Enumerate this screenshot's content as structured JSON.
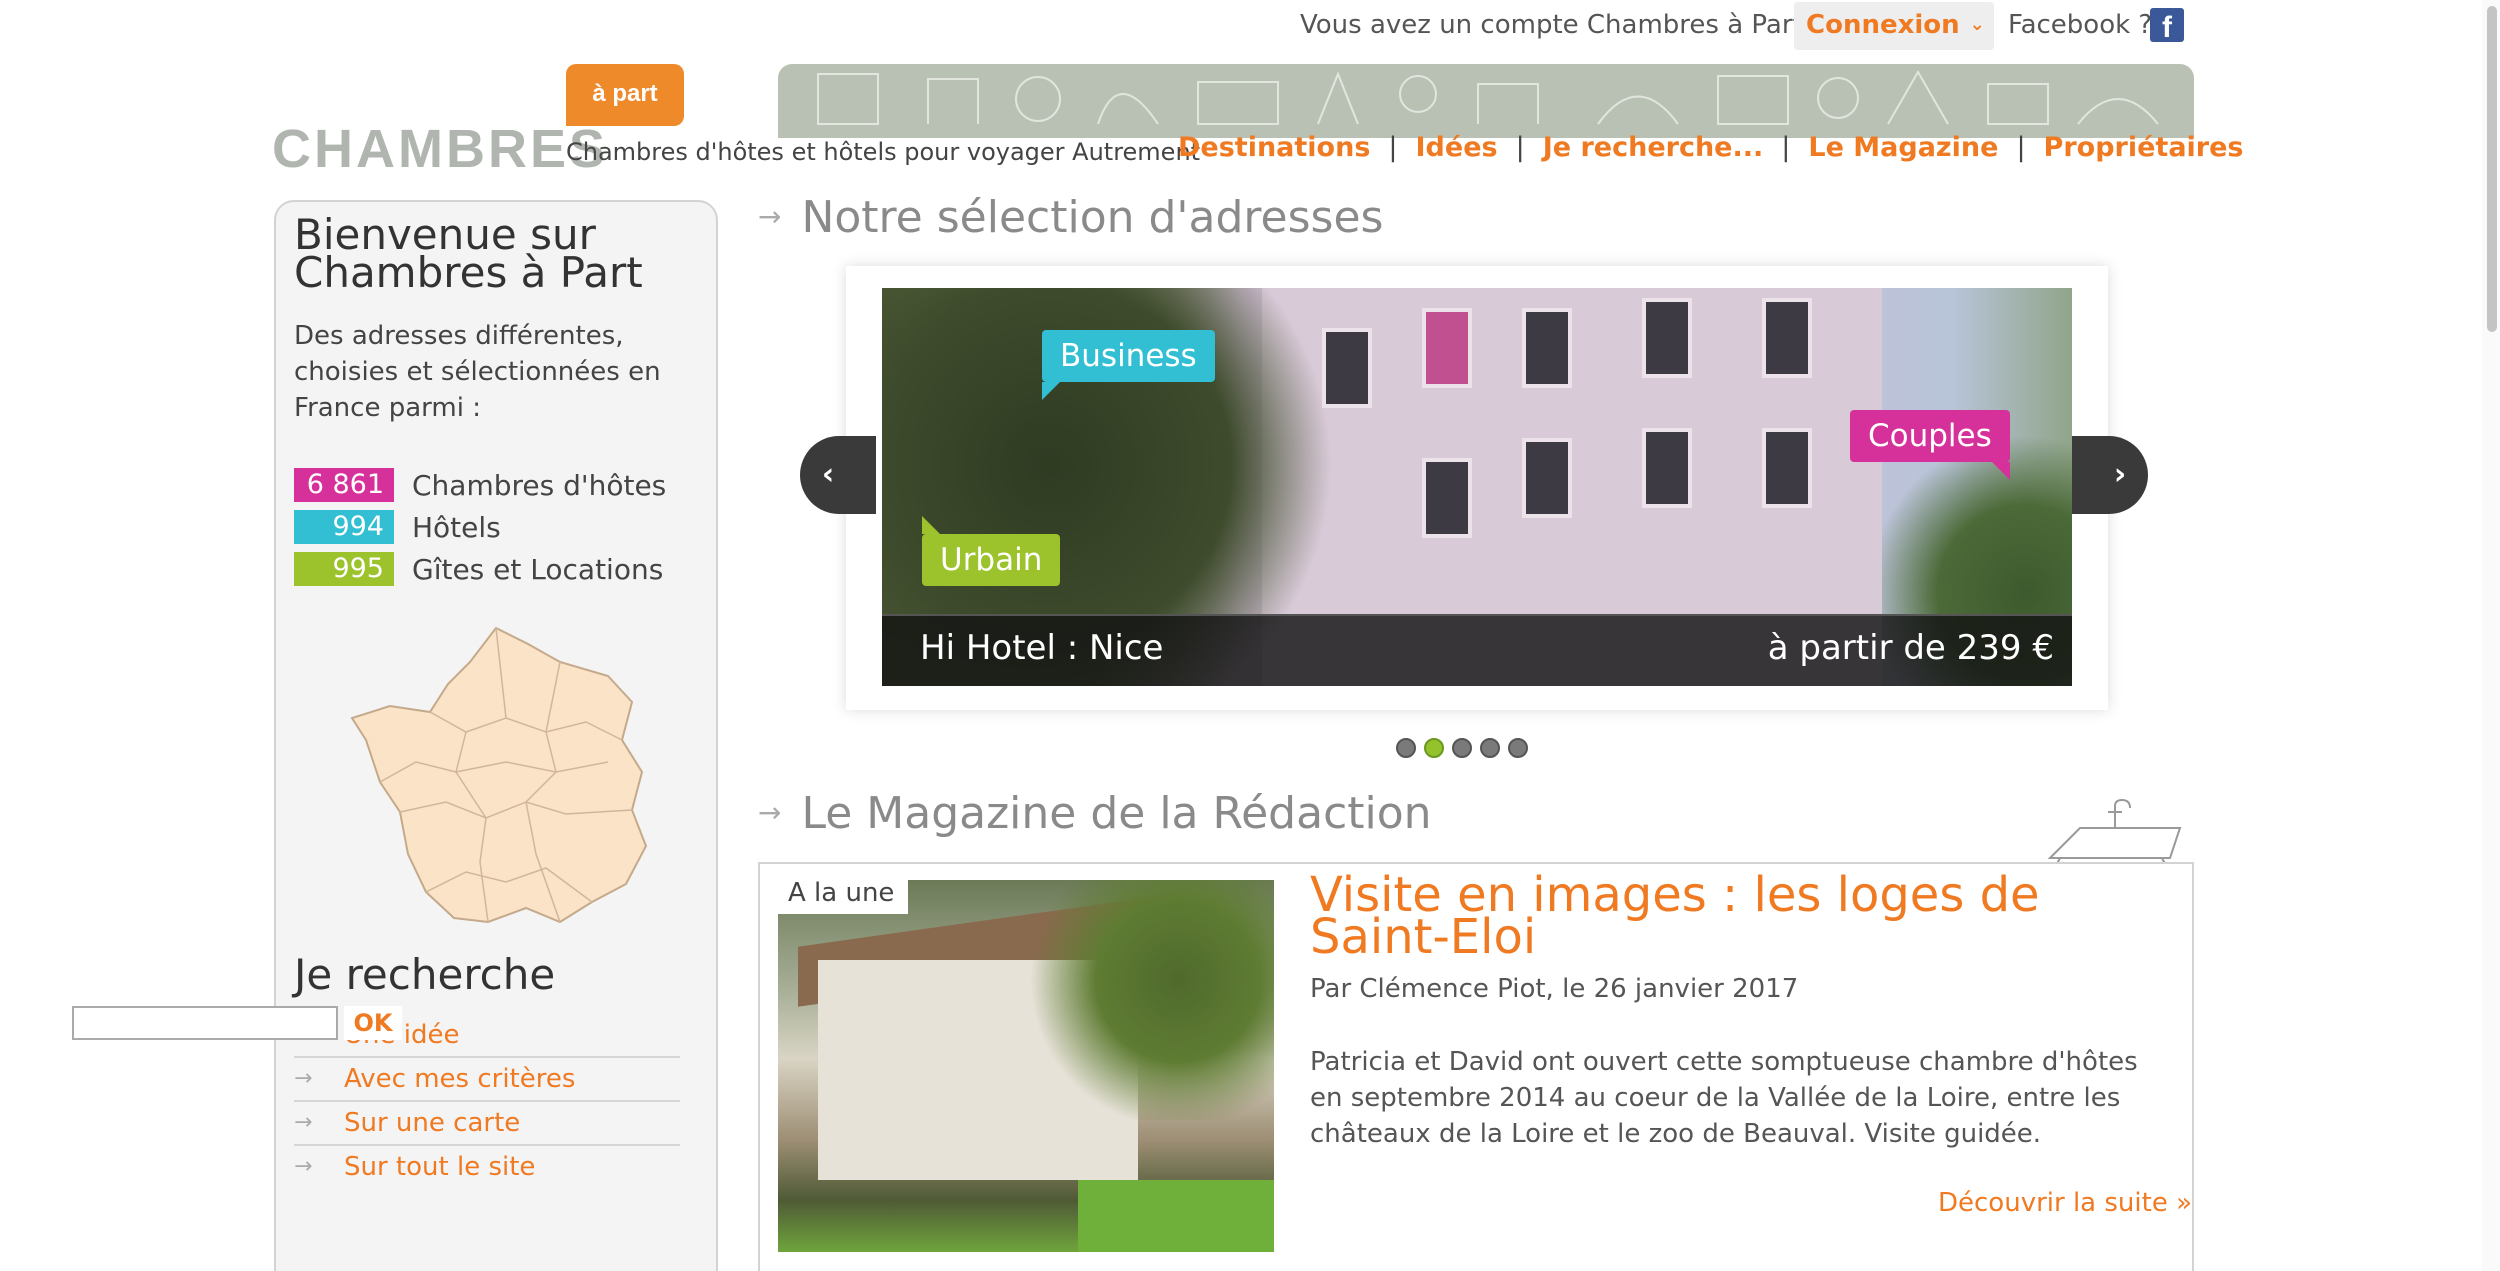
{
  "topbar": {
    "account_text": "Vous avez un compte Chambres à Part ?",
    "connexion_label": "Connexion",
    "facebook_label": "Facebook ?",
    "facebook_icon": "facebook-icon",
    "facebook_glyph": "f"
  },
  "header": {
    "logo_text": "CHAMBRES",
    "logo_tag": "à part",
    "slogan": "Chambres d'hôtes et hôtels pour voyager Autrement",
    "nav": [
      "Destinations",
      "Idées",
      "Je recherche...",
      "Le Magazine",
      "Propriétaires"
    ],
    "nav_separator": "|"
  },
  "sidebar": {
    "welcome_title": "Bienvenue sur Chambres à Part",
    "intro": "Des adresses différentes, choisies et sélectionnées en France parmi :",
    "counts": [
      {
        "value": "6 861",
        "label": "Chambres d'hôtes",
        "color": "#d6319a"
      },
      {
        "value": "994",
        "label": "Hôtels",
        "color": "#32bfd3"
      },
      {
        "value": "995",
        "label": "Gîtes et Locations",
        "color": "#9cc32b"
      }
    ],
    "search_title": "Je recherche",
    "search_links": [
      "Une idée",
      "Avec mes critères",
      "Sur une carte",
      "Sur tout le site"
    ],
    "search_input_value": "",
    "ok_label": "OK"
  },
  "selection": {
    "title": "Notre sélection d'adresses",
    "slide": {
      "name": "Hi Hotel : Nice",
      "price": "à partir de 239 €",
      "tags": [
        "Business",
        "Couples",
        "Urbain"
      ]
    },
    "prev_glyph": "‹",
    "next_glyph": "›",
    "dots_total": 5,
    "dots_active_index": 1
  },
  "magazine": {
    "title": "Le Magazine de la Rédaction",
    "badge": "A la une",
    "article_title": "Visite en images : les loges de Saint-Eloi",
    "byline": "Par Clémence Piot, le 26 janvier 2017",
    "excerpt": "Patricia et David ont ouvert cette somptueuse chambre d'hôtes en septembre 2014 au coeur de la Vallée de la Loire, entre les châteaux de la Loire et le zoo de Beauval. Visite guidée.",
    "more_link": "Découvrir la suite »"
  },
  "colors": {
    "accent": "#ef7a22",
    "pink": "#d6319a",
    "cyan": "#32bfd3",
    "green": "#9cc32b"
  }
}
